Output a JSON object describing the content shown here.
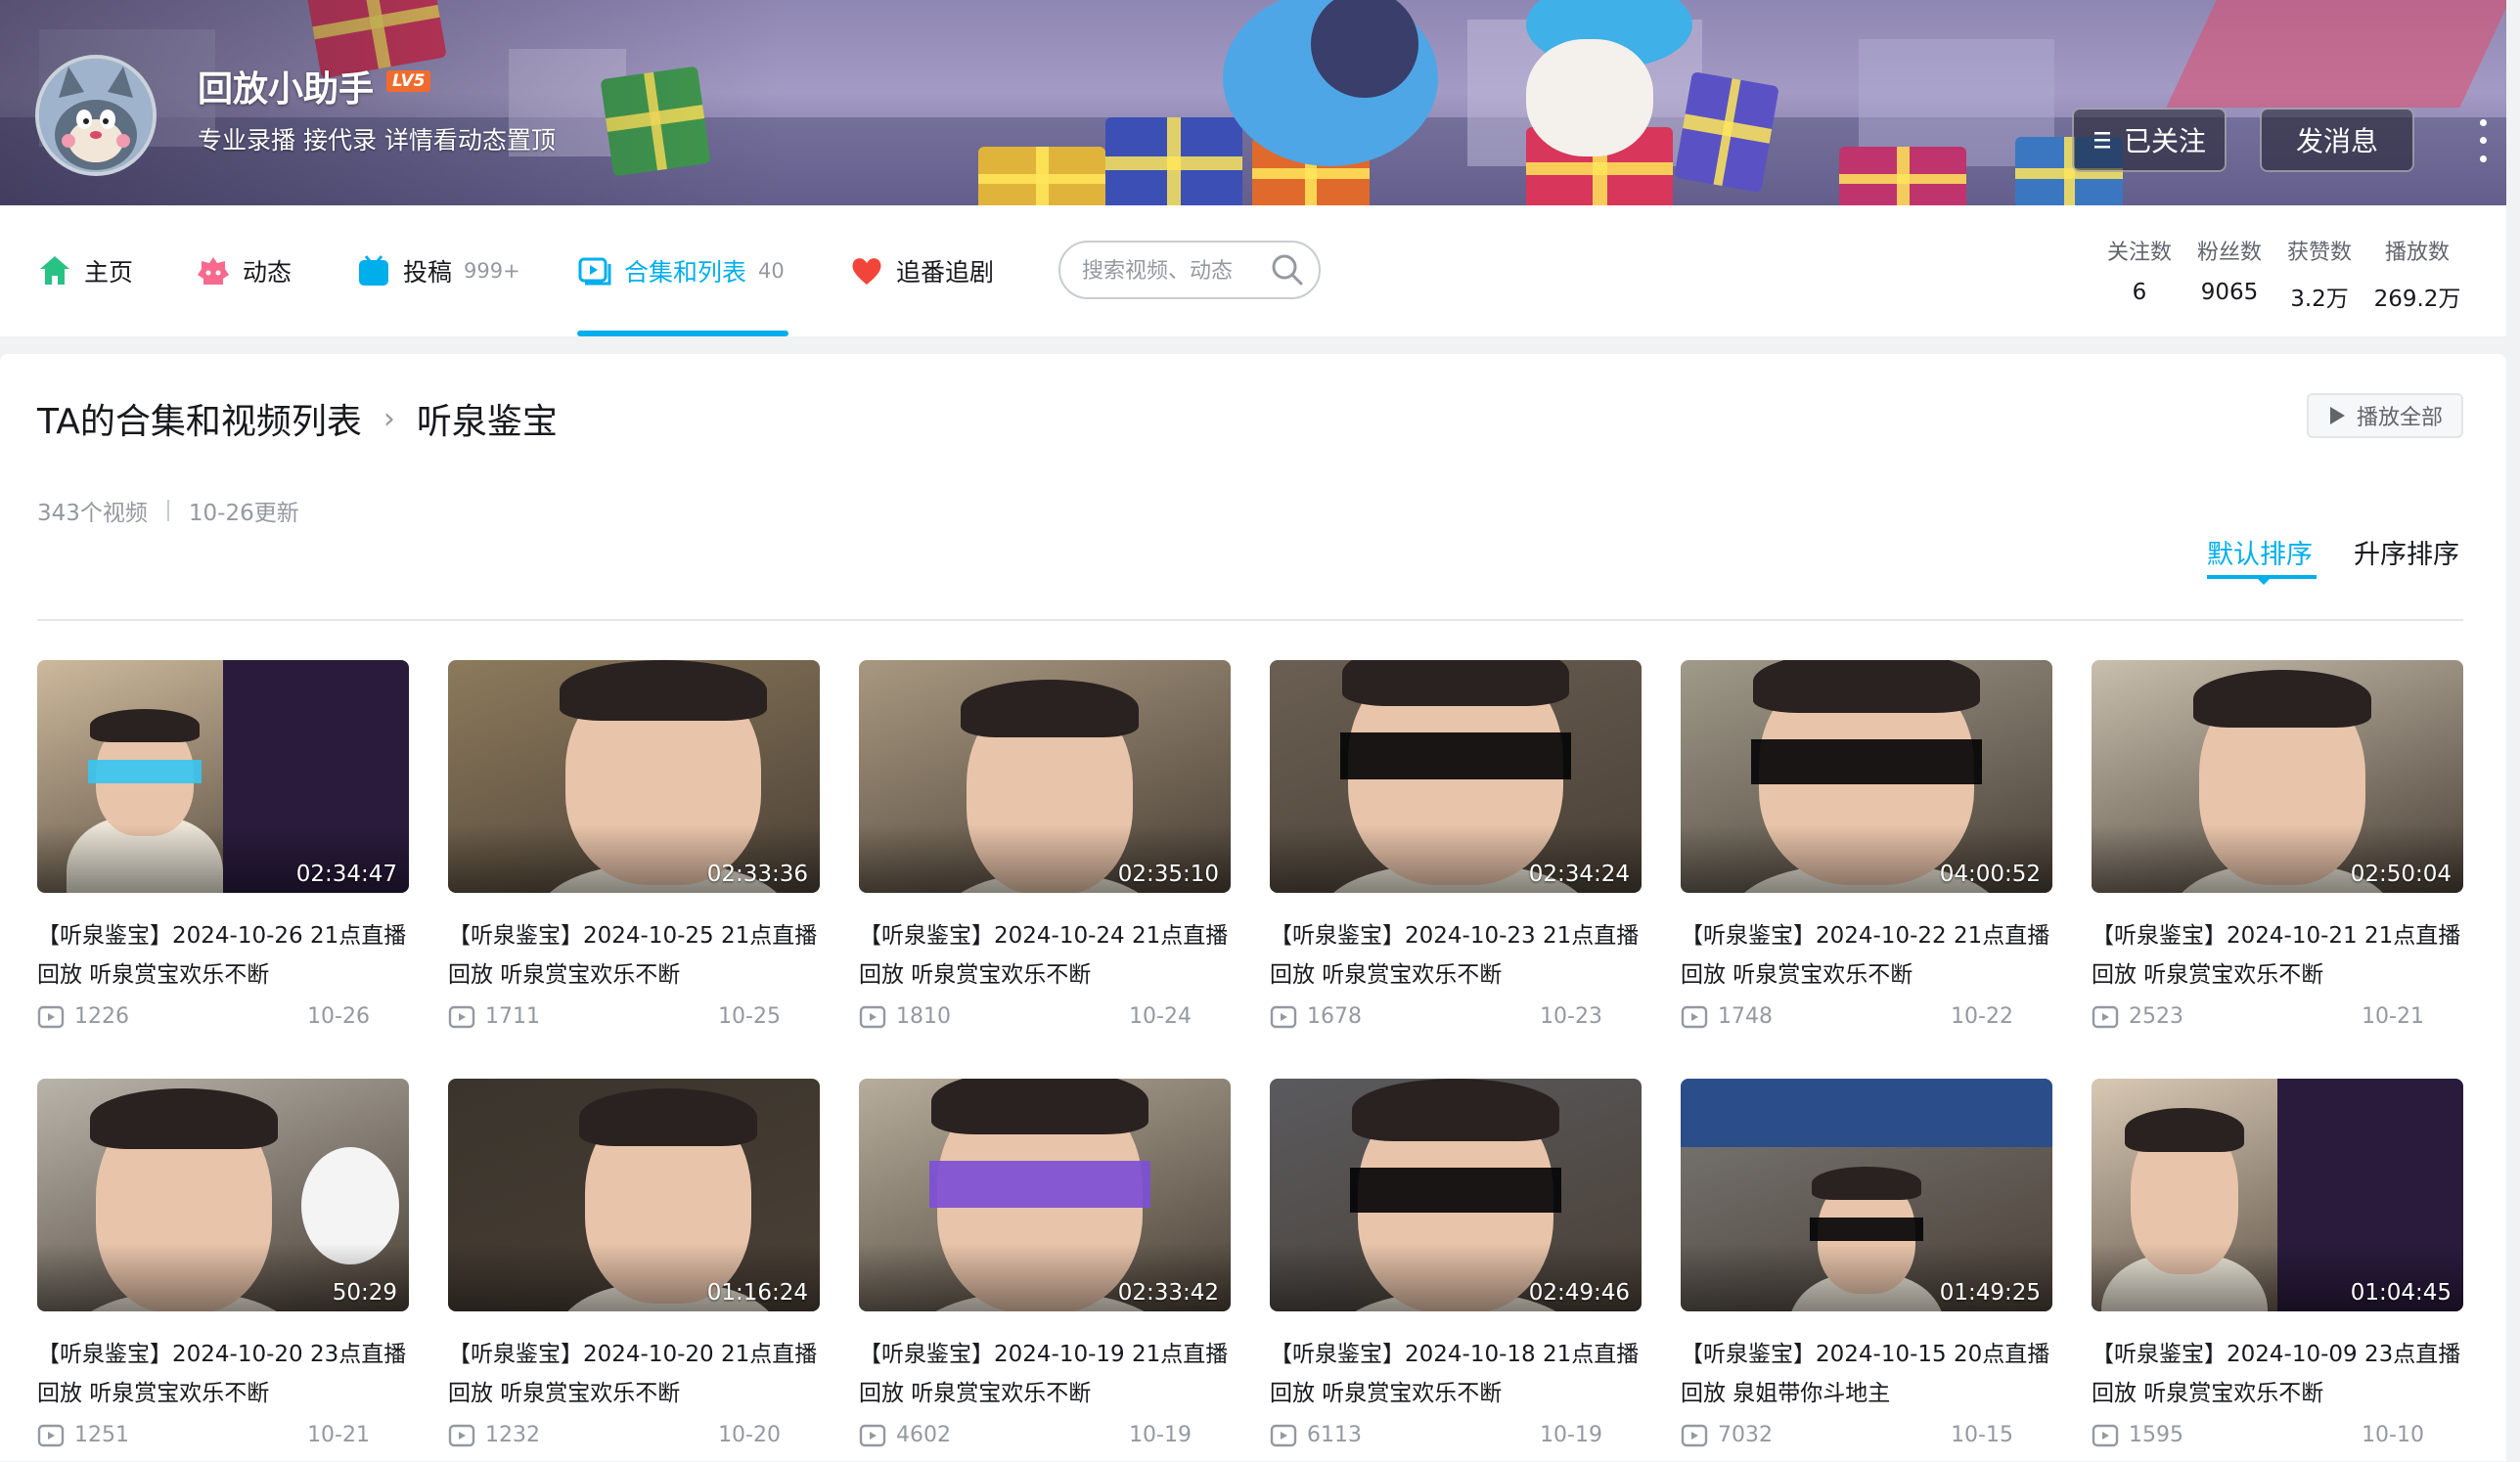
{
  "profile": {
    "username": "回放小助手",
    "level": "LV5",
    "sign": "专业录播 接代录 详情看动态置顶",
    "follow_button": "已关注",
    "message_button": "发消息"
  },
  "nav": {
    "home": "主页",
    "dynamic": "动态",
    "uploads": "投稿",
    "uploads_count": "999+",
    "collection": "合集和列表",
    "collection_count": "40",
    "bangumi": "追番追剧",
    "search_placeholder": "搜索视频、动态"
  },
  "stats": [
    {
      "label": "关注数",
      "value": "6"
    },
    {
      "label": "粉丝数",
      "value": "9065"
    },
    {
      "label": "获赞数",
      "value": "3.2万"
    },
    {
      "label": "播放数",
      "value": "269.2万"
    }
  ],
  "list": {
    "breadcrumb_root": "TA的合集和视频列表",
    "breadcrumb_current": "听泉鉴宝",
    "play_all": "播放全部",
    "video_count": "343个视频",
    "updated": "10-26更新",
    "sort_default": "默认排序",
    "sort_asc": "升序排序"
  },
  "colors": {
    "accent": "#00aeec",
    "text": "#18191c",
    "muted": "#9499a0"
  },
  "videos": [
    {
      "title": "【听泉鉴宝】2024-10-26 21点直播回放 听泉赏宝欢乐不断",
      "duration": "02:34:47",
      "plays": "1226",
      "date": "10-26"
    },
    {
      "title": "【听泉鉴宝】2024-10-25 21点直播回放 听泉赏宝欢乐不断",
      "duration": "02:33:36",
      "plays": "1711",
      "date": "10-25"
    },
    {
      "title": "【听泉鉴宝】2024-10-24 21点直播回放 听泉赏宝欢乐不断",
      "duration": "02:35:10",
      "plays": "1810",
      "date": "10-24"
    },
    {
      "title": "【听泉鉴宝】2024-10-23 21点直播回放 听泉赏宝欢乐不断",
      "duration": "02:34:24",
      "plays": "1678",
      "date": "10-23"
    },
    {
      "title": "【听泉鉴宝】2024-10-22 21点直播回放 听泉赏宝欢乐不断",
      "duration": "04:00:52",
      "plays": "1748",
      "date": "10-22"
    },
    {
      "title": "【听泉鉴宝】2024-10-21 21点直播回放 听泉赏宝欢乐不断",
      "duration": "02:50:04",
      "plays": "2523",
      "date": "10-21"
    },
    {
      "title": "【听泉鉴宝】2024-10-20 23点直播回放 听泉赏宝欢乐不断",
      "duration": "50:29",
      "plays": "1251",
      "date": "10-21"
    },
    {
      "title": "【听泉鉴宝】2024-10-20 21点直播回放 听泉赏宝欢乐不断",
      "duration": "01:16:24",
      "plays": "1232",
      "date": "10-20"
    },
    {
      "title": "【听泉鉴宝】2024-10-19 21点直播回放 听泉赏宝欢乐不断",
      "duration": "02:33:42",
      "plays": "4602",
      "date": "10-19"
    },
    {
      "title": "【听泉鉴宝】2024-10-18 21点直播回放 听泉赏宝欢乐不断",
      "duration": "02:49:46",
      "plays": "6113",
      "date": "10-19"
    },
    {
      "title": "【听泉鉴宝】2024-10-15 20点直播回放 泉姐带你斗地主",
      "duration": "01:49:25",
      "plays": "7032",
      "date": "10-15"
    },
    {
      "title": "【听泉鉴宝】2024-10-09 23点直播回放 听泉赏宝欢乐不断",
      "duration": "01:04:45",
      "plays": "1595",
      "date": "10-10"
    }
  ]
}
